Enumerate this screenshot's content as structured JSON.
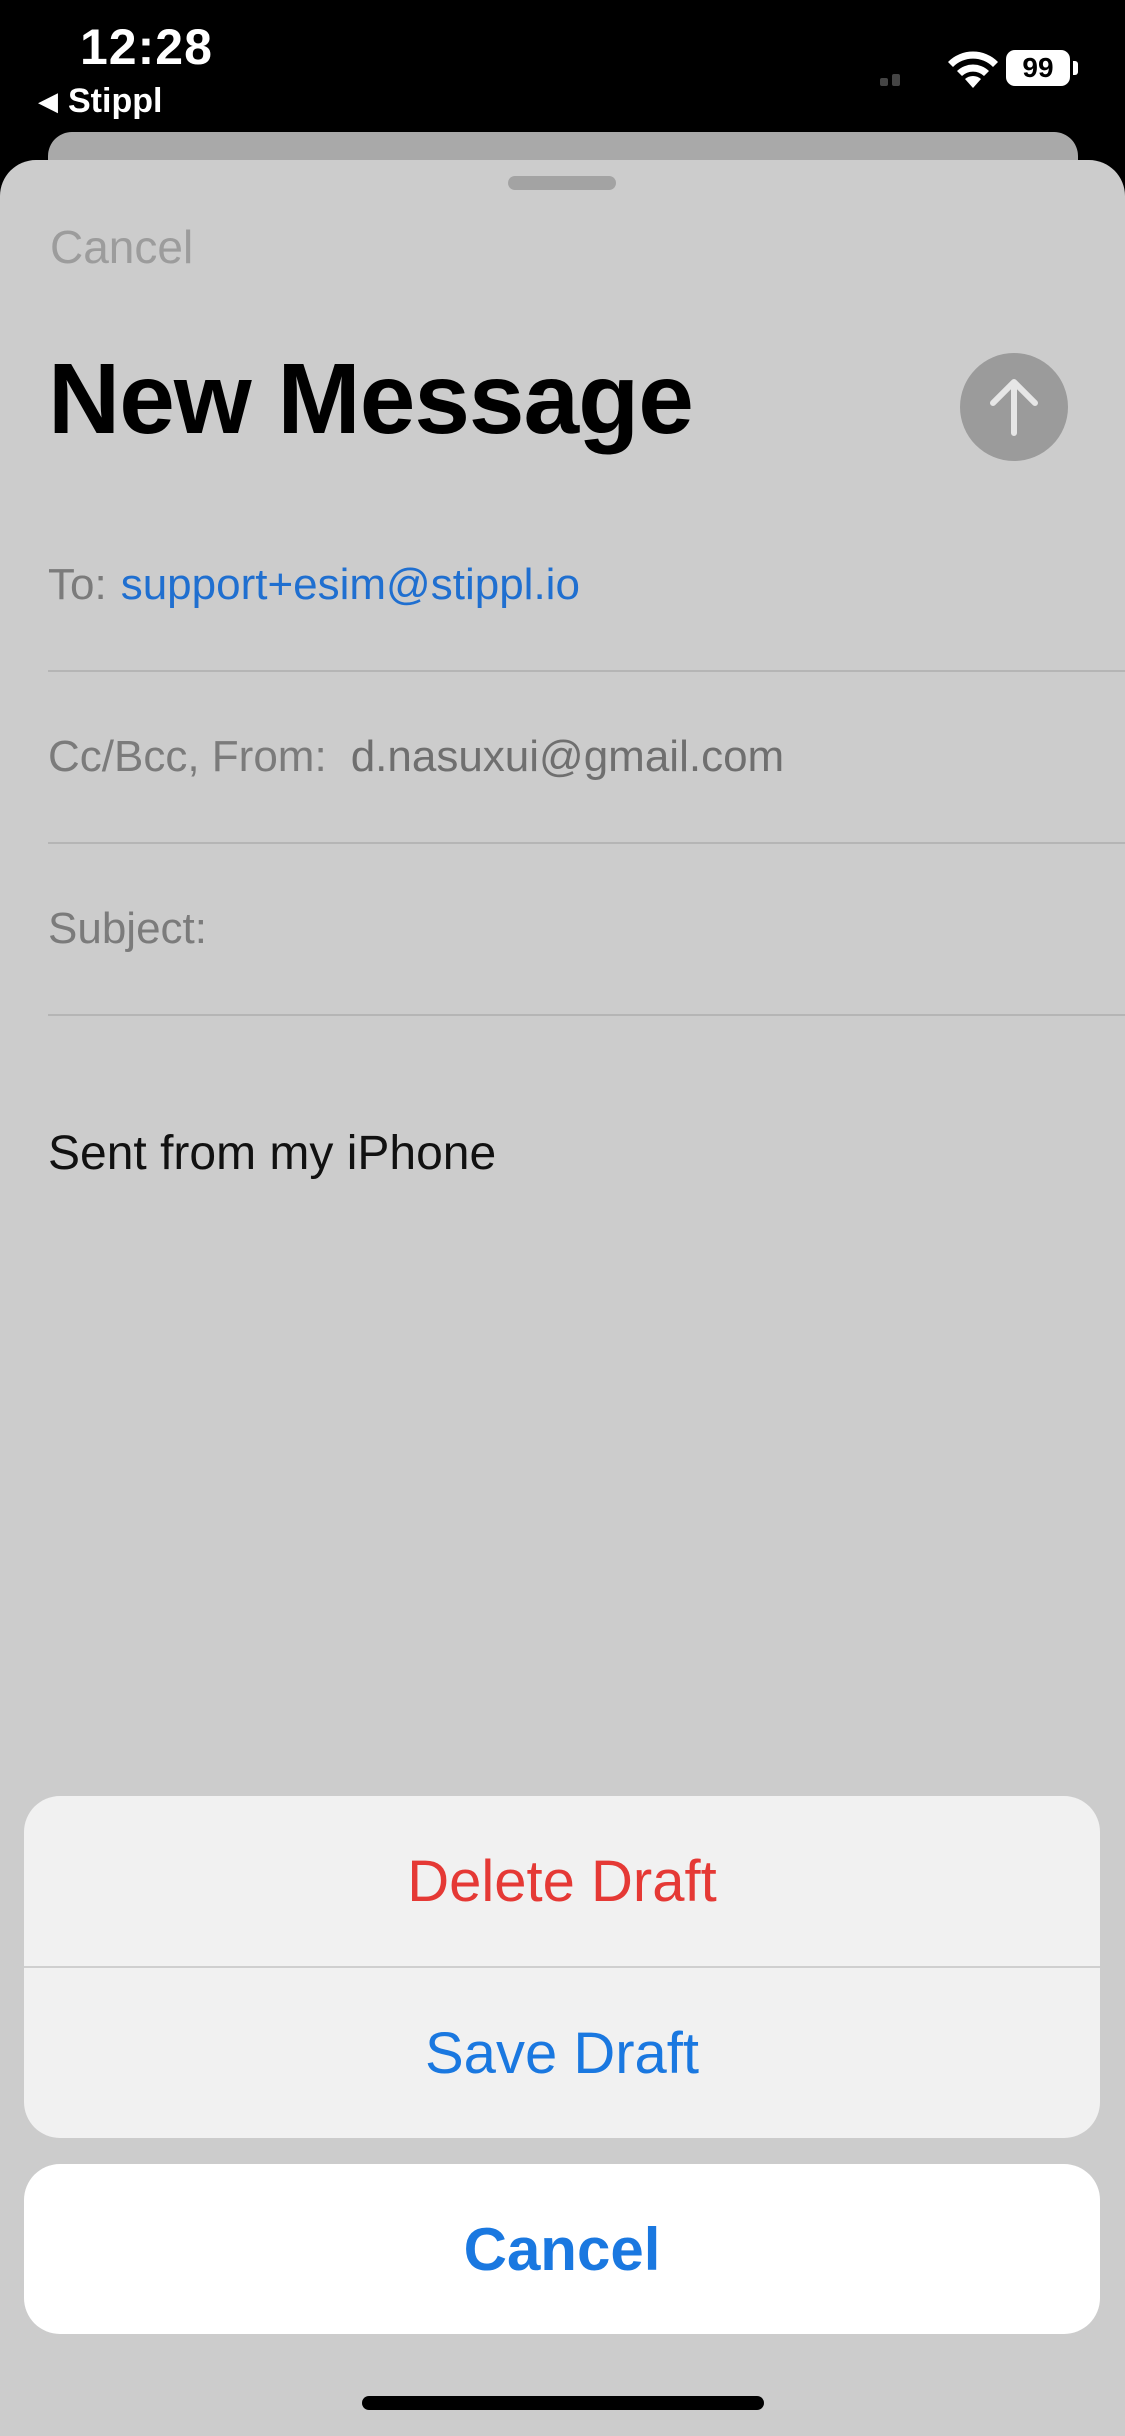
{
  "status_bar": {
    "time": "12:28",
    "back_app": "Stippl",
    "back_icon": "back-caret-icon",
    "battery": "99"
  },
  "compose": {
    "cancel_label": "Cancel",
    "title": "New Message",
    "send_icon": "arrow-up-icon",
    "to_label": "To:",
    "to_value": "support+esim@stippl.io",
    "cc_label": "Cc/Bcc, From:",
    "from_value": "d.nasuxui@gmail.com",
    "subject_label": "Subject:",
    "body": "Sent from my iPhone"
  },
  "action_sheet": {
    "delete_label": "Delete Draft",
    "save_label": "Save Draft",
    "cancel_label": "Cancel"
  },
  "colors": {
    "destructive": "#e53935",
    "accent": "#1a78e0",
    "link": "#1f6fd0",
    "sheet_bg": "#cccccc"
  }
}
